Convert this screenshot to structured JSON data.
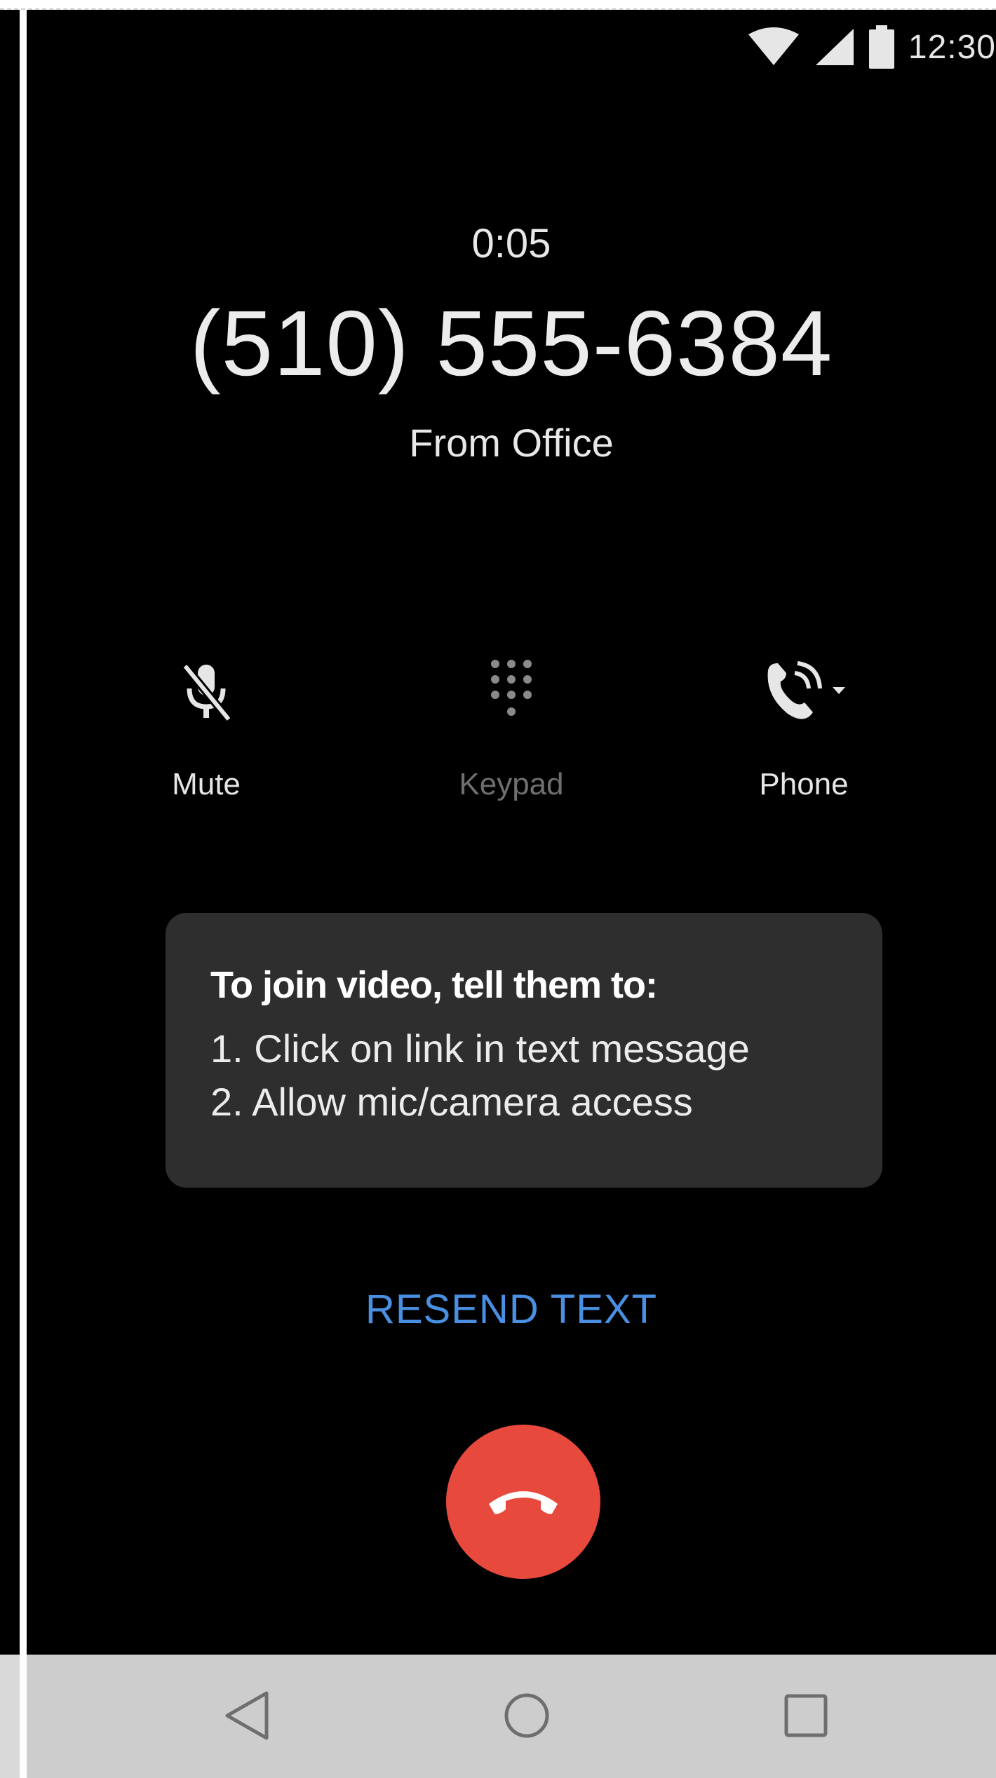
{
  "status_bar": {
    "clock": "12:30",
    "icons": [
      "wifi-icon",
      "cell-signal-icon",
      "battery-icon"
    ]
  },
  "call": {
    "timer": "0:05",
    "number": "(510) 555-6384",
    "caller_label": "From Office"
  },
  "controls": {
    "mute": {
      "label": "Mute",
      "icon": "mic-off-icon",
      "enabled": true
    },
    "keypad": {
      "label": "Keypad",
      "icon": "dialpad-icon",
      "enabled": false
    },
    "phone": {
      "label": "Phone",
      "icon": "phone-audio-icon",
      "enabled": true
    }
  },
  "info_card": {
    "title": "To join video, tell them to:",
    "steps": [
      "1. Click on link in text message",
      "2. Allow mic/camera access"
    ]
  },
  "resend_label": "RESEND TEXT",
  "end_call": {
    "icon": "call-end-icon"
  },
  "nav": {
    "back_icon": "back-triangle-icon",
    "home_icon": "home-circle-icon",
    "recents_icon": "recents-square-icon"
  },
  "colors": {
    "accent": "#4a90e2",
    "end_call": "#e8493d",
    "card_bg": "#2e2e2e",
    "screen_bg": "#000000",
    "nav_bg": "#cdcdcd"
  }
}
